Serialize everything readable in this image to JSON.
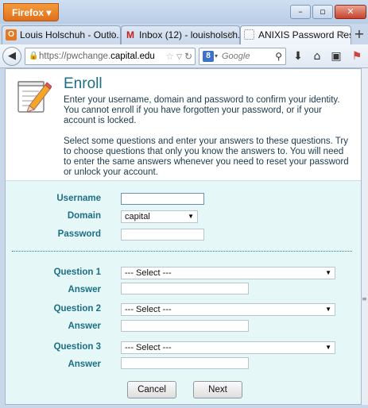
{
  "browser": {
    "menu_label": "Firefox",
    "tabs": [
      {
        "label": "Louis Holschuh - Outlo...",
        "icon": "outlook-icon"
      },
      {
        "label": "Inbox (12) - louisholsch...",
        "icon": "gmail-icon"
      },
      {
        "label": "ANIXIS Password Reset: ...",
        "icon": "page-icon"
      }
    ],
    "url_prefix": "https://pwchange.",
    "url_domain": "capital.edu",
    "search_placeholder": "Google"
  },
  "page": {
    "title": "Enroll",
    "intro1": "Enter your username, domain and password to confirm your identity. You cannot enroll if you have forgotten your password, or if your account is locked.",
    "intro2": "Select some questions and enter your answers to these questions. Try to choose questions that only you know the answers to. You will need to enter the same answers whenever you need to reset your password or unlock your account."
  },
  "form": {
    "username_label": "Username",
    "username_value": "",
    "domain_label": "Domain",
    "domain_value": "capital",
    "password_label": "Password",
    "password_value": "",
    "questions": [
      {
        "label": "Question 1",
        "value": "--- Select ---",
        "answer_label": "Answer",
        "answer_value": ""
      },
      {
        "label": "Question 2",
        "value": "--- Select ---",
        "answer_label": "Answer",
        "answer_value": ""
      },
      {
        "label": "Question 3",
        "value": "--- Select ---",
        "answer_label": "Answer",
        "answer_value": ""
      }
    ],
    "cancel_label": "Cancel",
    "next_label": "Next"
  },
  "colors": {
    "accent": "#1b6f86",
    "form_bg": "#e6f7f7",
    "firefox_orange": "#e87722"
  }
}
